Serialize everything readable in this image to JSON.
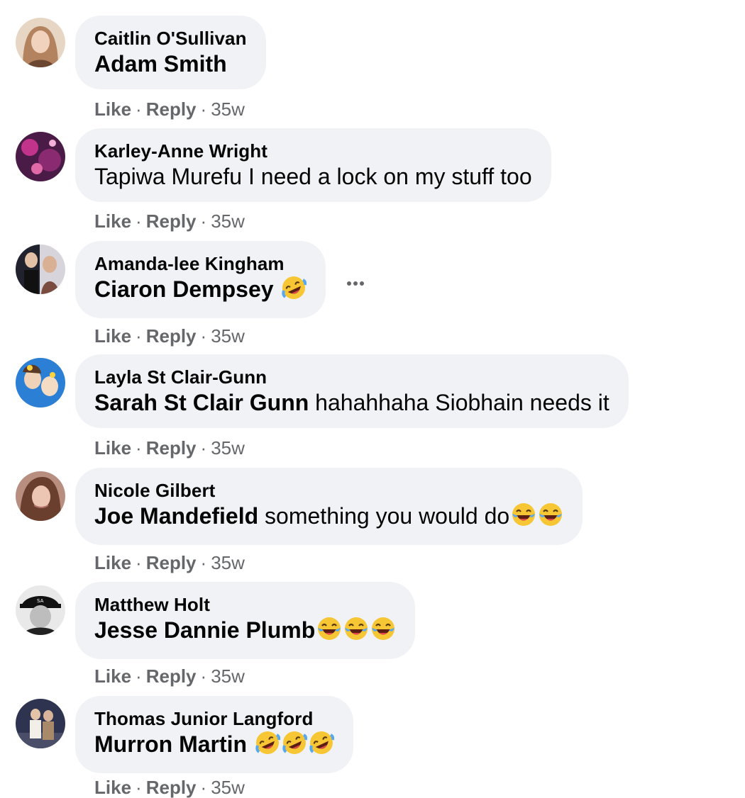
{
  "comments": [
    {
      "author": "Caitlin O'Sullivan",
      "mention": "Adam Smith",
      "text": "",
      "emoji_count": 0,
      "emoji_name": "",
      "action_like": "Like",
      "action_reply": "Reply",
      "time": "35w",
      "avatar_colors": [
        "#d9b79a",
        "#7a4a2f"
      ]
    },
    {
      "author": "Karley-Anne Wright",
      "mention": "",
      "text": "Tapiwa Murefu I need a lock on my stuff too",
      "emoji_count": 0,
      "emoji_name": "",
      "action_like": "Like",
      "action_reply": "Reply",
      "time": "35w",
      "avatar_colors": [
        "#7a1a6a",
        "#c24a8a"
      ]
    },
    {
      "author": "Amanda-lee Kingham",
      "mention": "Ciaron Dempsey",
      "text": "",
      "emoji_count": 1,
      "emoji_name": "rolling-on-floor-laughing-emoji",
      "action_like": "Like",
      "action_reply": "Reply",
      "time": "35w",
      "avatar_colors": [
        "#1c1f2b",
        "#6b5a59"
      ]
    },
    {
      "author": "Layla St Clair-Gunn",
      "mention": "Sarah St Clair Gunn",
      "text": "hahahhaha Siobhain needs it",
      "emoji_count": 0,
      "emoji_name": "",
      "action_like": "Like",
      "action_reply": "Reply",
      "time": "35w",
      "avatar_colors": [
        "#2f7bd1",
        "#e6d0b8"
      ]
    },
    {
      "author": "Nicole Gilbert",
      "mention": "Joe Mandefield",
      "text": "something you would do",
      "emoji_count": 2,
      "emoji_name": "tears-of-joy-emoji",
      "action_like": "Like",
      "action_reply": "Reply",
      "time": "35w",
      "avatar_colors": [
        "#c9a08e",
        "#6a4036"
      ]
    },
    {
      "author": "Matthew Holt",
      "mention": "Jesse Dannie Plumb",
      "text": "",
      "emoji_count": 3,
      "emoji_name": "tears-of-joy-emoji",
      "action_like": "Like",
      "action_reply": "Reply",
      "time": "35w",
      "avatar_colors": [
        "#1a1a1a",
        "#8a8a8a"
      ]
    },
    {
      "author": "Thomas Junior Langford",
      "mention": "Murron Martin",
      "text": "",
      "emoji_count": 3,
      "emoji_name": "rolling-on-floor-laughing-emoji",
      "action_like": "Like",
      "action_reply": "Reply",
      "time": "35w",
      "avatar_colors": [
        "#3a3f52",
        "#c7b7a3"
      ]
    }
  ],
  "more_menu": "...",
  "colors": {
    "bubble": "#f0f2f5",
    "secondary_text": "#65676b",
    "primary_text": "#050505"
  }
}
